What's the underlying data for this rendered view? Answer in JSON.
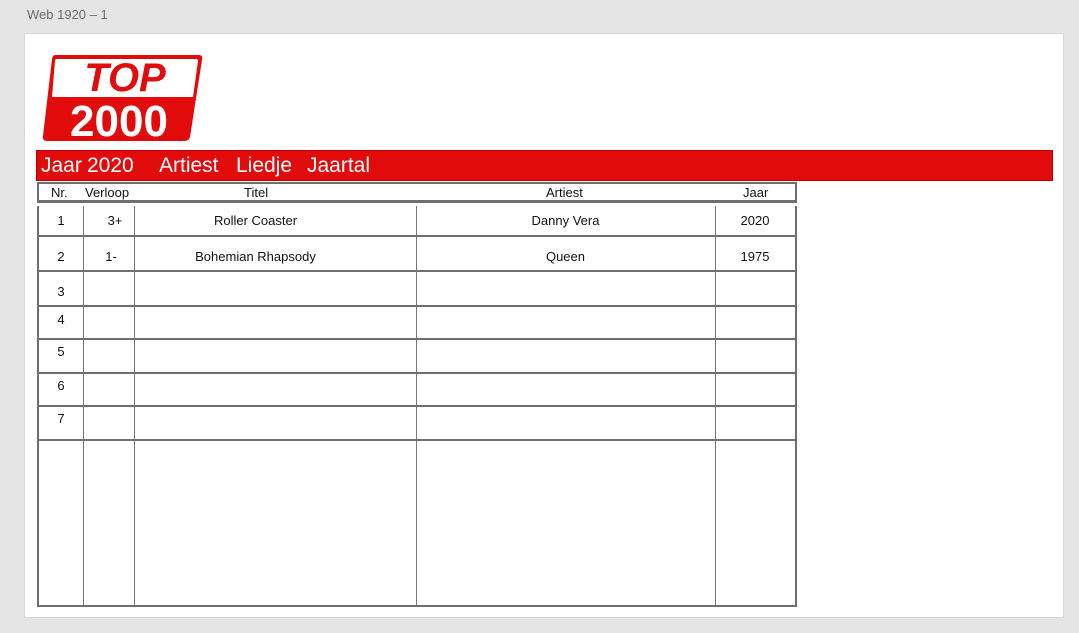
{
  "artboard": {
    "label": "Web 1920 – 1"
  },
  "logo": {
    "line1": "TOP",
    "line2": "2000",
    "color": "#e20b0b"
  },
  "nav": {
    "items": [
      "Jaar",
      "2020",
      "Artiest",
      "Liedje",
      "Jaartal"
    ]
  },
  "table": {
    "headers": [
      "Nr.",
      "Verloop",
      "Titel",
      "Artiest",
      "Jaar"
    ],
    "rows": [
      {
        "nr": "1",
        "verloop": "3+",
        "titel": "Roller Coaster",
        "artiest": "Danny Vera",
        "jaar": "2020"
      },
      {
        "nr": "2",
        "verloop": "1-",
        "titel": "Bohemian Rhapsody",
        "artiest": "Queen",
        "jaar": "1975"
      },
      {
        "nr": "3",
        "verloop": "",
        "titel": "",
        "artiest": "",
        "jaar": ""
      },
      {
        "nr": "4",
        "verloop": "",
        "titel": "",
        "artiest": "",
        "jaar": ""
      },
      {
        "nr": "5",
        "verloop": "",
        "titel": "",
        "artiest": "",
        "jaar": ""
      },
      {
        "nr": "6",
        "verloop": "",
        "titel": "",
        "artiest": "",
        "jaar": ""
      },
      {
        "nr": "7",
        "verloop": "",
        "titel": "",
        "artiest": "",
        "jaar": ""
      }
    ]
  }
}
